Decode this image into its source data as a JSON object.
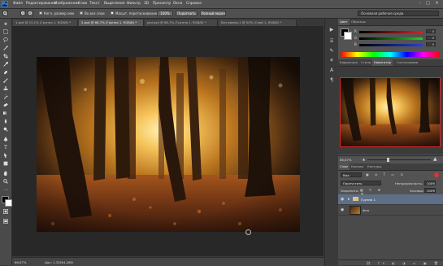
{
  "app": {
    "logo": "Ps"
  },
  "menu": [
    "Файл",
    "Редактирование",
    "Изображение",
    "Слои",
    "Текст",
    "Выделение",
    "Фильтр",
    "3D",
    "Просмотр",
    "Окно",
    "Справка"
  ],
  "window_controls": {
    "minimize": "–",
    "maximize": "□",
    "close": "✕"
  },
  "options": {
    "sample_size_label": "Кегл. размер нем",
    "all_layers_label": "Во все слои",
    "scrubby_zoom_label": "Масшт. перетаскиванием",
    "zoom_100_label": "100%",
    "fit_screen_label": "Подогнать",
    "fill_screen_label": "Полный экран",
    "workspace": "Основная рабочая среда"
  },
  "tabs": [
    {
      "label": "1.psd @ 13,1% (Группа 1, RGB/8) *",
      "active": false
    },
    {
      "label": "2.psd @ 66,7% (Группа 1, RGB/8) *",
      "active": true
    },
    {
      "label": "psd.psd @ 66,7% (Группа 1, RGB/8) *",
      "active": false
    },
    {
      "label": "Без имени-1 @ 50% (Слой 1, RGB/8) *",
      "active": false
    }
  ],
  "status": {
    "zoom": "66,67%",
    "doc": "Док: 1,32M/4,28M"
  },
  "color_panel": {
    "tabs": [
      "Цвет",
      "Образцы"
    ],
    "sliders": [
      {
        "label": "R",
        "value": "0",
        "color": "#d43a3a"
      },
      {
        "label": "G",
        "value": "0",
        "color": "#3ac23a"
      },
      {
        "label": "B",
        "value": "0",
        "color": "#3a5ad4"
      }
    ]
  },
  "navigator_panel": {
    "tabs": [
      "Коррекция",
      "Стили",
      "Навигатор",
      "Гистограмма"
    ],
    "active_tab": "Навигатор",
    "zoom": "66,67%"
  },
  "layers_panel": {
    "tabs": [
      "Слои",
      "Каналы",
      "Контуры"
    ],
    "kind_filter": "Вид",
    "blend_mode": "Пропустить",
    "opacity_label": "Непрозрачность:",
    "opacity": "100%",
    "lock_label": "Закрепить:",
    "fill_label": "Заливка:",
    "fill": "100%",
    "layers": [
      {
        "name": "Группа 1",
        "type": "group",
        "selected": true
      },
      {
        "name": "Фон",
        "type": "image",
        "selected": false
      }
    ]
  },
  "tools": [
    "move",
    "marquee",
    "lasso",
    "quick-select",
    "crop",
    "eyedropper",
    "healing",
    "brush",
    "stamp",
    "history-brush",
    "eraser",
    "gradient",
    "blur",
    "dodge",
    "pen",
    "type",
    "path-select",
    "shape",
    "hand",
    "zoom"
  ]
}
